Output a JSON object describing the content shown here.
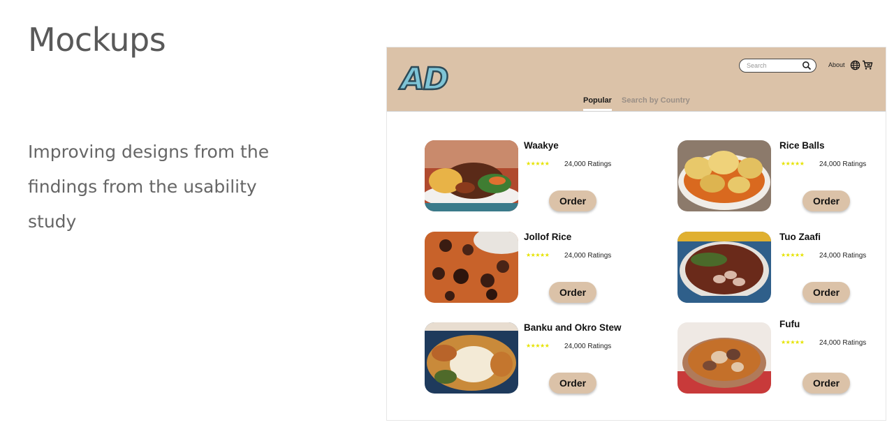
{
  "slide": {
    "title": "Mockups",
    "description": "Improving designs from the findings from the usability study"
  },
  "app": {
    "logo": "AD",
    "search_placeholder": "Search",
    "about_label": "About",
    "tabs": [
      {
        "label": "Popular",
        "active": true
      },
      {
        "label": "Search by Country",
        "active": false
      }
    ],
    "stars": "★★★★★",
    "items": [
      {
        "name": "Waakye",
        "ratings": "24,000 Ratings",
        "order_label": "Order"
      },
      {
        "name": "Rice Balls",
        "ratings": "24,000 Ratings",
        "order_label": "Order"
      },
      {
        "name": "Jollof Rice",
        "ratings": "24,000 Ratings",
        "order_label": "Order"
      },
      {
        "name": "Tuo Zaafi",
        "ratings": "24,000 Ratings",
        "order_label": "Order"
      },
      {
        "name": "Banku and Okro Stew",
        "ratings": "24,000 Ratings",
        "order_label": "Order"
      },
      {
        "name": "Fufu",
        "ratings": "24,000 Ratings",
        "order_label": "Order"
      }
    ]
  },
  "colors": {
    "header_bg": "#dbc2a8",
    "order_button": "#dbc2a8",
    "star": "#e6e300",
    "logo_fill": "#7ec4d6",
    "logo_stroke": "#2d4a57"
  },
  "icons": [
    "search-icon",
    "globe-icon",
    "cart-icon",
    "star-icon"
  ]
}
